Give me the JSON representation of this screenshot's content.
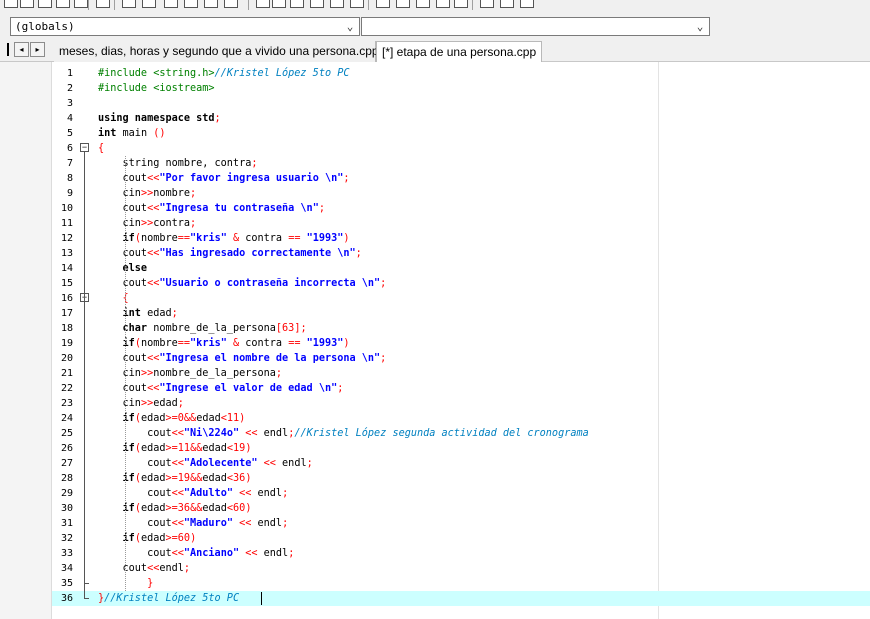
{
  "globals_combo": {
    "value": "(globals)"
  },
  "second_combo": {
    "value": ""
  },
  "tabs": [
    {
      "label": "meses, dias, horas y segundo que a vivido una persona.cpp",
      "active": false
    },
    {
      "label": "[*] etapa de una persona.cpp",
      "active": true
    }
  ],
  "nav_prev": "◂",
  "nav_next": "▸",
  "toolbar_icons": [
    "new-file-icon",
    "open-file-icon",
    "save-icon",
    "save-all-icon",
    "close-icon",
    "print-icon",
    "undo-icon",
    "redo-icon",
    "find-icon",
    "replace-icon",
    "find-next-icon",
    "goto-icon",
    "compile-icon",
    "run-icon",
    "compile-run-icon",
    "rebuild-icon",
    "debug-icon",
    "stop-icon",
    "class-icon",
    "new-class-icon",
    "check-icon",
    "chart-icon",
    "delete-icon",
    "window-icon",
    "project-icon",
    "help-icon"
  ],
  "colors": {
    "current_line": "#ccffff",
    "string": "#0000ff",
    "operator": "#ff0000",
    "comment": "#0080c0",
    "preprocessor": "#008000"
  },
  "lines": [
    {
      "n": "1",
      "tokens": [
        [
          "pre",
          "#include <string.h>"
        ],
        [
          "com",
          "//Kristel López 5to PC"
        ]
      ]
    },
    {
      "n": "2",
      "tokens": [
        [
          "pre",
          "#include <iostream>"
        ]
      ]
    },
    {
      "n": "3",
      "tokens": []
    },
    {
      "n": "4",
      "tokens": [
        [
          "kw",
          "using namespace std"
        ],
        [
          "op",
          ";"
        ]
      ]
    },
    {
      "n": "5",
      "tokens": [
        [
          "kw",
          "int"
        ],
        [
          "plain",
          " main "
        ],
        [
          "op",
          "()"
        ]
      ]
    },
    {
      "n": "6",
      "tokens": [
        [
          "op",
          "{"
        ]
      ]
    },
    {
      "n": "7",
      "tokens": [
        [
          "plain",
          "    string nombre, contra"
        ],
        [
          "op",
          ";"
        ]
      ]
    },
    {
      "n": "8",
      "tokens": [
        [
          "plain",
          "    cout"
        ],
        [
          "op",
          "<<"
        ],
        [
          "str",
          "\"Por favor ingresa usuario \\n\""
        ],
        [
          "op",
          ";"
        ]
      ]
    },
    {
      "n": "9",
      "tokens": [
        [
          "plain",
          "    cin"
        ],
        [
          "op",
          ">>"
        ],
        [
          "plain",
          "nombre"
        ],
        [
          "op",
          ";"
        ]
      ]
    },
    {
      "n": "10",
      "tokens": [
        [
          "plain",
          "    cout"
        ],
        [
          "op",
          "<<"
        ],
        [
          "str",
          "\"Ingresa tu contraseña \\n\""
        ],
        [
          "op",
          ";"
        ]
      ]
    },
    {
      "n": "11",
      "tokens": [
        [
          "plain",
          "    cin"
        ],
        [
          "op",
          ">>"
        ],
        [
          "plain",
          "contra"
        ],
        [
          "op",
          ";"
        ]
      ]
    },
    {
      "n": "12",
      "tokens": [
        [
          "kw",
          "    if"
        ],
        [
          "op",
          "("
        ],
        [
          "plain",
          "nombre"
        ],
        [
          "op",
          "=="
        ],
        [
          "str",
          "\"kris\""
        ],
        [
          "op",
          " & "
        ],
        [
          "plain",
          "contra "
        ],
        [
          "op",
          "=="
        ],
        [
          "str",
          " \"1993\""
        ],
        [
          "op",
          ")"
        ]
      ]
    },
    {
      "n": "13",
      "tokens": [
        [
          "plain",
          "    cout"
        ],
        [
          "op",
          "<<"
        ],
        [
          "str",
          "\"Has ingresado correctamente \\n\""
        ],
        [
          "op",
          ";"
        ]
      ]
    },
    {
      "n": "14",
      "tokens": [
        [
          "kw",
          "    else"
        ]
      ]
    },
    {
      "n": "15",
      "tokens": [
        [
          "plain",
          "    cout"
        ],
        [
          "op",
          "<<"
        ],
        [
          "str",
          "\"Usuario o contraseña incorrecta \\n\""
        ],
        [
          "op",
          ";"
        ]
      ]
    },
    {
      "n": "16",
      "tokens": [
        [
          "op",
          "    {"
        ]
      ]
    },
    {
      "n": "17",
      "tokens": [
        [
          "kw",
          "    int"
        ],
        [
          "plain",
          " edad"
        ],
        [
          "op",
          ";"
        ]
      ]
    },
    {
      "n": "18",
      "tokens": [
        [
          "kw",
          "    char"
        ],
        [
          "plain",
          " nombre_de_la_persona"
        ],
        [
          "op",
          "["
        ],
        [
          "num",
          "63"
        ],
        [
          "op",
          "];"
        ]
      ]
    },
    {
      "n": "19",
      "tokens": [
        [
          "kw",
          "    if"
        ],
        [
          "op",
          "("
        ],
        [
          "plain",
          "nombre"
        ],
        [
          "op",
          "=="
        ],
        [
          "str",
          "\"kris\""
        ],
        [
          "op",
          " & "
        ],
        [
          "plain",
          "contra "
        ],
        [
          "op",
          "=="
        ],
        [
          "str",
          " \"1993\""
        ],
        [
          "op",
          ")"
        ]
      ]
    },
    {
      "n": "20",
      "tokens": [
        [
          "plain",
          "    cout"
        ],
        [
          "op",
          "<<"
        ],
        [
          "str",
          "\"Ingresa el nombre de la persona \\n\""
        ],
        [
          "op",
          ";"
        ]
      ]
    },
    {
      "n": "21",
      "tokens": [
        [
          "plain",
          "    cin"
        ],
        [
          "op",
          ">>"
        ],
        [
          "plain",
          "nombre_de_la_persona"
        ],
        [
          "op",
          ";"
        ]
      ]
    },
    {
      "n": "22",
      "tokens": [
        [
          "plain",
          "    cout"
        ],
        [
          "op",
          "<<"
        ],
        [
          "str",
          "\"Ingrese el valor de edad \\n\""
        ],
        [
          "op",
          ";"
        ]
      ]
    },
    {
      "n": "23",
      "tokens": [
        [
          "plain",
          "    cin"
        ],
        [
          "op",
          ">>"
        ],
        [
          "plain",
          "edad"
        ],
        [
          "op",
          ";"
        ]
      ]
    },
    {
      "n": "24",
      "tokens": [
        [
          "kw",
          "    if"
        ],
        [
          "op",
          "("
        ],
        [
          "plain",
          "edad"
        ],
        [
          "op",
          ">="
        ],
        [
          "num",
          "0"
        ],
        [
          "op",
          "&&"
        ],
        [
          "plain",
          "edad"
        ],
        [
          "op",
          "<"
        ],
        [
          "num",
          "11"
        ],
        [
          "op",
          ")"
        ]
      ]
    },
    {
      "n": "25",
      "tokens": [
        [
          "plain",
          "        cout"
        ],
        [
          "op",
          "<<"
        ],
        [
          "str",
          "\"Ni\\224o\""
        ],
        [
          "op",
          " << "
        ],
        [
          "plain",
          "endl"
        ],
        [
          "op",
          ";"
        ],
        [
          "com",
          "//Kristel López segunda actividad del cronograma"
        ]
      ]
    },
    {
      "n": "26",
      "tokens": [
        [
          "kw",
          "    if"
        ],
        [
          "op",
          "("
        ],
        [
          "plain",
          "edad"
        ],
        [
          "op",
          ">="
        ],
        [
          "num",
          "11"
        ],
        [
          "op",
          "&&"
        ],
        [
          "plain",
          "edad"
        ],
        [
          "op",
          "<"
        ],
        [
          "num",
          "19"
        ],
        [
          "op",
          ")"
        ]
      ]
    },
    {
      "n": "27",
      "tokens": [
        [
          "plain",
          "        cout"
        ],
        [
          "op",
          "<<"
        ],
        [
          "str",
          "\"Adolecente\""
        ],
        [
          "op",
          " << "
        ],
        [
          "plain",
          "endl"
        ],
        [
          "op",
          ";"
        ]
      ]
    },
    {
      "n": "28",
      "tokens": [
        [
          "kw",
          "    if"
        ],
        [
          "op",
          "("
        ],
        [
          "plain",
          "edad"
        ],
        [
          "op",
          ">="
        ],
        [
          "num",
          "19"
        ],
        [
          "op",
          "&&"
        ],
        [
          "plain",
          "edad"
        ],
        [
          "op",
          "<"
        ],
        [
          "num",
          "36"
        ],
        [
          "op",
          ")"
        ]
      ]
    },
    {
      "n": "29",
      "tokens": [
        [
          "plain",
          "        cout"
        ],
        [
          "op",
          "<<"
        ],
        [
          "str",
          "\"Adulto\""
        ],
        [
          "op",
          " << "
        ],
        [
          "plain",
          "endl"
        ],
        [
          "op",
          ";"
        ]
      ]
    },
    {
      "n": "30",
      "tokens": [
        [
          "kw",
          "    if"
        ],
        [
          "op",
          "("
        ],
        [
          "plain",
          "edad"
        ],
        [
          "op",
          ">="
        ],
        [
          "num",
          "36"
        ],
        [
          "op",
          "&&"
        ],
        [
          "plain",
          "edad"
        ],
        [
          "op",
          "<"
        ],
        [
          "num",
          "60"
        ],
        [
          "op",
          ")"
        ]
      ]
    },
    {
      "n": "31",
      "tokens": [
        [
          "plain",
          "        cout"
        ],
        [
          "op",
          "<<"
        ],
        [
          "str",
          "\"Maduro\""
        ],
        [
          "op",
          " << "
        ],
        [
          "plain",
          "endl"
        ],
        [
          "op",
          ";"
        ]
      ]
    },
    {
      "n": "32",
      "tokens": [
        [
          "kw",
          "    if"
        ],
        [
          "op",
          "("
        ],
        [
          "plain",
          "edad"
        ],
        [
          "op",
          ">="
        ],
        [
          "num",
          "60"
        ],
        [
          "op",
          ")"
        ]
      ]
    },
    {
      "n": "33",
      "tokens": [
        [
          "plain",
          "        cout"
        ],
        [
          "op",
          "<<"
        ],
        [
          "str",
          "\"Anciano\""
        ],
        [
          "op",
          " << "
        ],
        [
          "plain",
          "endl"
        ],
        [
          "op",
          ";"
        ]
      ]
    },
    {
      "n": "34",
      "tokens": [
        [
          "plain",
          "    cout"
        ],
        [
          "op",
          "<<"
        ],
        [
          "plain",
          "endl"
        ],
        [
          "op",
          ";"
        ]
      ]
    },
    {
      "n": "35",
      "tokens": [
        [
          "op",
          "        }"
        ]
      ]
    },
    {
      "n": "36",
      "tokens": [
        [
          "op",
          "}"
        ],
        [
          "com",
          "//Kristel López 5to PC"
        ]
      ]
    }
  ],
  "current_line": "36",
  "fold_markers": {
    "open": "−"
  }
}
